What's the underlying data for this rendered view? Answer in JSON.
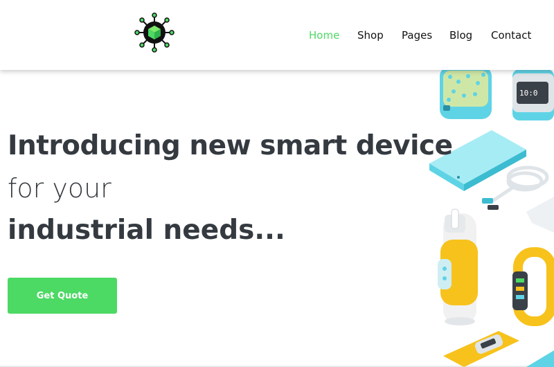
{
  "header": {
    "logo_icon": "network-cube-logo-icon",
    "nav": [
      {
        "label": "Home",
        "active": true
      },
      {
        "label": "Shop",
        "active": false
      },
      {
        "label": "Pages",
        "active": false
      },
      {
        "label": "Blog",
        "active": false
      },
      {
        "label": "Contact",
        "active": false
      }
    ]
  },
  "hero": {
    "line1": "Introducing new smart device",
    "line2": "for your",
    "line3": "industrial needs...",
    "cta_label": "Get Quote",
    "illustration_icon": "smart-devices-illustration"
  },
  "colors": {
    "accent": "#4cd964",
    "text": "#343a40",
    "device_cyan": "#5fd3e6",
    "device_yellow": "#f7c21c"
  }
}
